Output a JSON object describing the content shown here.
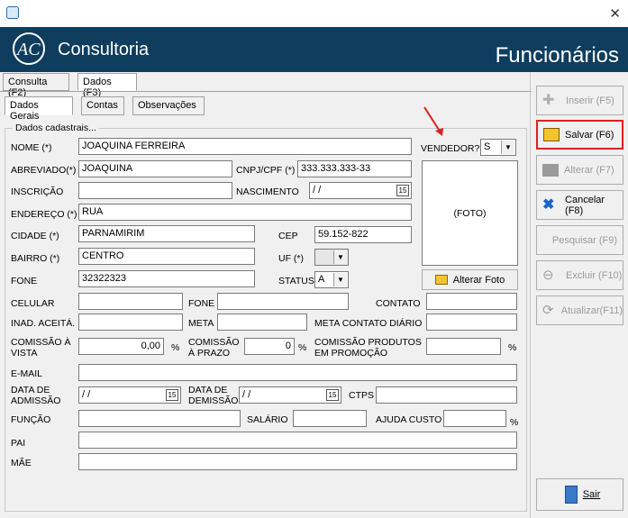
{
  "header": {
    "brand": "Consultoria",
    "title": "Funcionários"
  },
  "main_tabs": [
    "Consulta (F2)",
    "Dados (F3)"
  ],
  "sub_tabs": [
    "Dados Gerais",
    "Contas",
    "Observações"
  ],
  "group_title": "Dados cadastrais...",
  "labels": {
    "nome": "NOME (*)",
    "abreviado": "ABREVIADO(*)",
    "cnpj": "CNPJ/CPF (*)",
    "inscricao": "INSCRIÇÃO",
    "nascimento": "NASCIMENTO",
    "endereco": "ENDEREÇO (*)",
    "cidade": "CIDADE (*)",
    "cep": "CEP",
    "bairro": "BAIRRO (*)",
    "uf": "UF (*)",
    "fone": "FONE",
    "status": "STATUS",
    "vendedor": "VENDEDOR?",
    "foto": "(FOTO)",
    "alterar_foto": "Alterar Foto",
    "celular": "CELULAR",
    "fone2": "FONE",
    "contato": "CONTATO",
    "inad": "INAD. ACEITÁ.",
    "meta": "META",
    "meta_contato": "META CONTATO DIÁRIO",
    "comissao_vista_1": "COMISSÃO À",
    "comissao_vista_2": "VISTA",
    "comissao_prazo_1": "COMISSÃO",
    "comissao_prazo_2": "À PRAZO",
    "comissao_promo_1": "COMISSÃO PRODUTOS",
    "comissao_promo_2": "EM PROMOÇÃO",
    "pct": "%",
    "email": "E-MAIL",
    "admissao_1": "DATA DE",
    "admissao_2": "ADMISSÃO",
    "demissao_1": "DATA DE",
    "demissao_2": "DEMISSÃO",
    "ctps": "CTPS",
    "funcao": "FUNÇÃO",
    "salario": "SALÁRIO",
    "ajuda": "AJUDA CUSTO",
    "pai": "PAI",
    "mae": "MÃE"
  },
  "values": {
    "nome": "JOAQUINA FERREIRA",
    "abreviado": "JOAQUINA",
    "cnpj": "333.333.333-33",
    "nascimento": " / /",
    "endereco": "RUA",
    "cidade": "PARNAMIRIM",
    "cep": "59.152-822",
    "bairro": "CENTRO",
    "fone": "32322323",
    "status": "A",
    "vendedor": "S",
    "comissao_vista": "0,00",
    "comissao_prazo": "0",
    "admissao": " / /",
    "demissao": " / /"
  },
  "sidebar": {
    "inserir": "Inserir (F5)",
    "salvar": "Salvar (F6)",
    "alterar": "Alterar (F7)",
    "cancelar": "Cancelar (F8)",
    "pesquisar": "Pesquisar (F9)",
    "excluir": "Excluir (F10)",
    "atualizar": "Atualizar(F11)",
    "sair": "Sair"
  },
  "colors": {
    "header_bg": "#0f3d5e",
    "highlight": "#e02020",
    "arrow": "#e02020"
  }
}
